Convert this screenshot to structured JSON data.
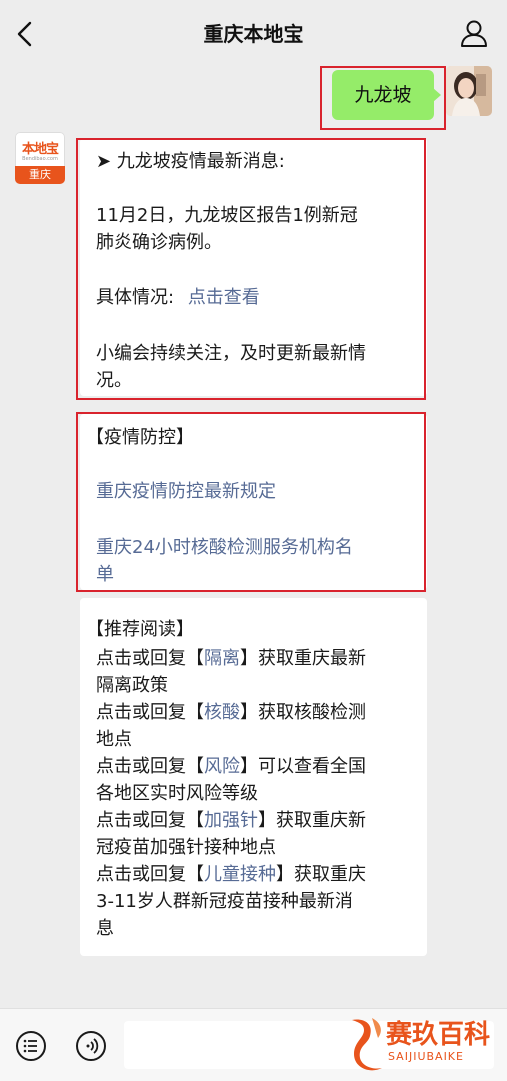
{
  "header": {
    "title": "重庆本地宝"
  },
  "user_message": {
    "text": "九龙坡"
  },
  "bot_avatar": {
    "logo_top": "本地宝",
    "logo_sub": "Bendibao.com",
    "logo_bottom": "重庆"
  },
  "card1": {
    "line1": "➤ 九龙坡疫情最新消息:",
    "line2": "11月2日，九龙坡区报告1例新冠",
    "line3": "肺炎确诊病例。",
    "line4_label": "具体情况:",
    "line4_link": "点击查看",
    "line5": "小编会持续关注，及时更新最新情",
    "line6": "况。"
  },
  "card2": {
    "heading": "【疫情防控】",
    "link1": "重庆疫情防控最新规定",
    "link2_line1": "重庆24小时核酸检测服务机构名",
    "link2_line2": "单"
  },
  "card3": {
    "heading": "【推荐阅读】",
    "items": [
      {
        "pre": "点击或回复【",
        "kw": "隔离",
        "post": "】获取重庆最新",
        "cont": "隔离政策"
      },
      {
        "pre": "点击或回复【",
        "kw": "核酸",
        "post": "】获取核酸检测",
        "cont": "地点"
      },
      {
        "pre": "点击或回复【",
        "kw": "风险",
        "post": "】可以查看全国",
        "cont": "各地区实时风险等级"
      },
      {
        "pre": "点击或回复【",
        "kw": "加强针",
        "post": "】获取重庆新",
        "cont": "冠疫苗加强针接种地点"
      },
      {
        "pre": "点击或回复【",
        "kw": "儿童接种",
        "post": "】获取重庆",
        "cont": "3-11岁人群新冠疫苗接种最新消",
        "cont2": "息"
      }
    ]
  },
  "watermark": {
    "text": "赛玖百科",
    "sub": "SAIJIUBAIKE"
  },
  "colors": {
    "link": "#576b95",
    "user_bubble": "#95ec69",
    "highlight": "#d9232d",
    "brand": "#e8541c"
  }
}
